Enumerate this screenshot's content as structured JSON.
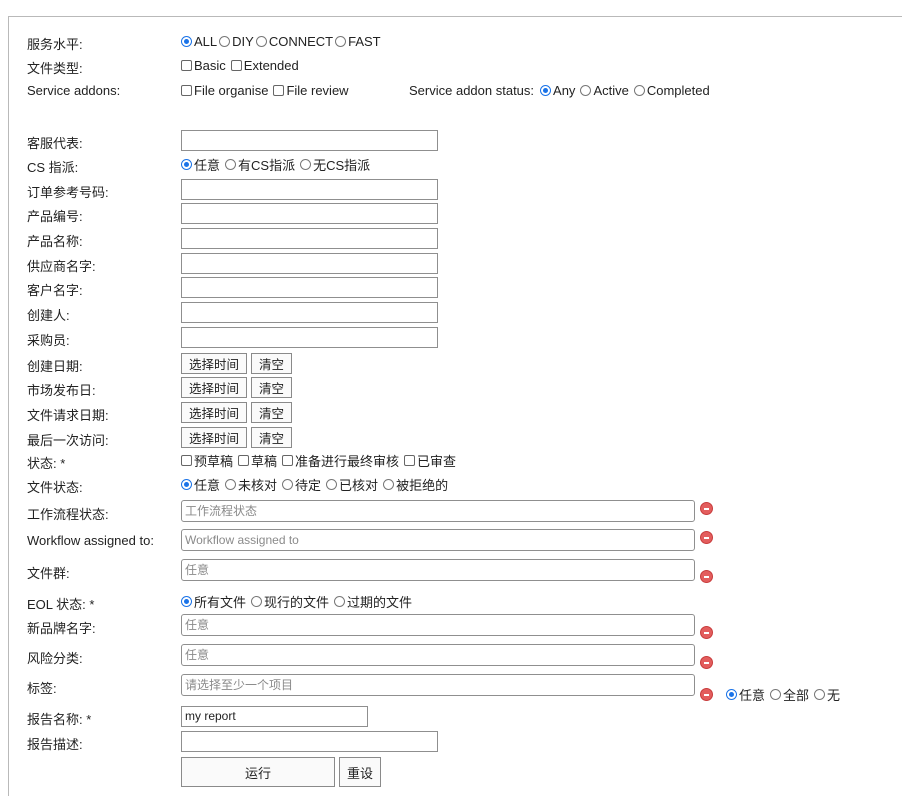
{
  "service_level": {
    "label": "服务水平:",
    "options": [
      "ALL",
      "DIY",
      "CONNECT",
      "FAST"
    ],
    "selected": "ALL"
  },
  "file_type": {
    "label": "文件类型:",
    "options": [
      "Basic",
      "Extended"
    ]
  },
  "service_addons": {
    "label": "Service addons:",
    "options": [
      "File organise",
      "File review"
    ]
  },
  "addon_status": {
    "label": "Service addon status:",
    "options": [
      "Any",
      "Active",
      "Completed"
    ],
    "selected": "Any"
  },
  "cs_rep": {
    "label": "客服代表:",
    "value": ""
  },
  "cs_assign": {
    "label": "CS 指派:",
    "options": [
      "任意",
      "有CS指派",
      "无CS指派"
    ],
    "selected": "任意"
  },
  "order_ref": {
    "label": "订单参考号码:",
    "value": ""
  },
  "product_code": {
    "label": "产品编号:",
    "value": ""
  },
  "product_name": {
    "label": "产品名称:",
    "value": ""
  },
  "supplier_name": {
    "label": "供应商名字:",
    "value": ""
  },
  "customer_name": {
    "label": "客户名字:",
    "value": ""
  },
  "creator": {
    "label": "创建人:",
    "value": ""
  },
  "buyer": {
    "label": "采购员:",
    "value": ""
  },
  "date_buttons": {
    "pick": "选择时间",
    "clear": "清空"
  },
  "created_date": {
    "label": "创建日期:"
  },
  "market_date": {
    "label": "市场发布日:"
  },
  "file_request_date": {
    "label": "文件请求日期:"
  },
  "last_visit": {
    "label": "最后一次访问:"
  },
  "status": {
    "label": "状态: *",
    "options": [
      "预草稿",
      "草稿",
      "准备进行最终审核",
      "已审查"
    ]
  },
  "file_status": {
    "label": "文件状态:",
    "options": [
      "任意",
      "未核对",
      "待定",
      "已核对",
      "被拒绝的"
    ],
    "selected": "任意"
  },
  "workflow_status": {
    "label": "工作流程状态:",
    "placeholder": "工作流程状态"
  },
  "workflow_assigned": {
    "label": "Workflow assigned to:",
    "placeholder": "Workflow assigned to"
  },
  "file_group": {
    "label": "文件群:",
    "placeholder": "任意"
  },
  "eol_status": {
    "label": "EOL 状态: *",
    "options": [
      "所有文件",
      "现行的文件",
      "过期的文件"
    ],
    "selected": "所有文件"
  },
  "new_brand": {
    "label": "新品牌名字:",
    "placeholder": "任意"
  },
  "risk_category": {
    "label": "风险分类:",
    "placeholder": "任意"
  },
  "tags": {
    "label": "标签:",
    "placeholder": "请选择至少一个项目",
    "options": [
      "任意",
      "全部",
      "无"
    ],
    "selected": "任意"
  },
  "report_name": {
    "label": "报告名称: *",
    "value": "my report"
  },
  "report_desc": {
    "label": "报告描述:",
    "value": ""
  },
  "actions": {
    "run": "运行",
    "reset": "重设"
  },
  "colors": {
    "accent": "#1a73e8",
    "remove": "#e35d5d"
  },
  "icons": {
    "remove": "remove-circle-icon"
  }
}
